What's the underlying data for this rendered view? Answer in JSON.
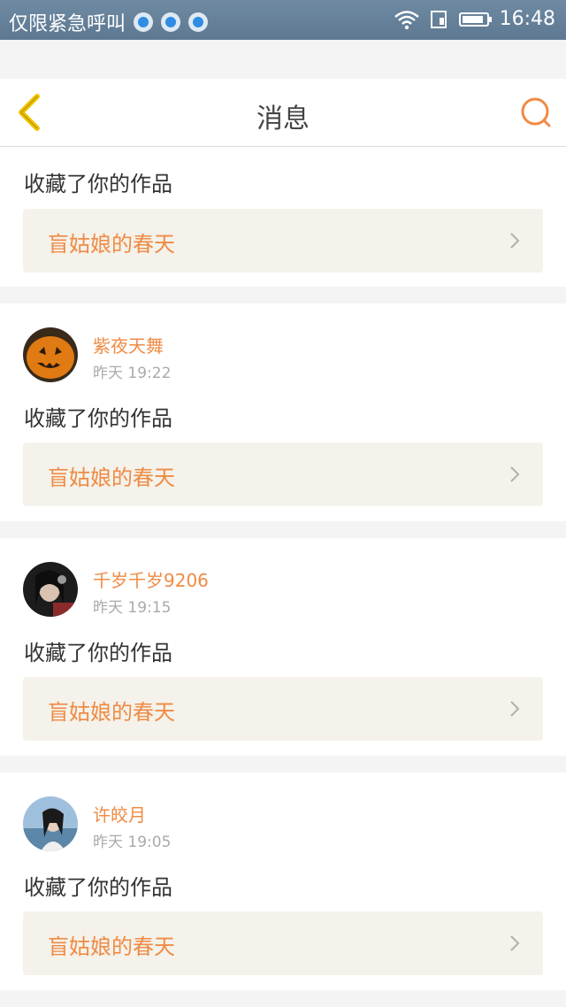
{
  "status_bar": {
    "carrier_text": "仅限紧急呼叫",
    "notification_icons": [
      "qq-icon",
      "qq-icon",
      "qq-icon"
    ],
    "time": "16:48"
  },
  "header": {
    "title": "消息",
    "back_icon": "chevron-left-icon",
    "search_icon": "search-icon"
  },
  "colors": {
    "accent": "#ef8b45",
    "back_icon": "#f2c300",
    "work_bg": "#f4f2ea"
  },
  "messages": [
    {
      "user": "",
      "time": "",
      "action": "收藏了你的作品",
      "work_title": "盲姑娘的春天"
    },
    {
      "user": "紫夜天舞",
      "time": "昨天 19:22",
      "action": "收藏了你的作品",
      "work_title": "盲姑娘的春天"
    },
    {
      "user": "千岁千岁9206",
      "time": "昨天 19:15",
      "action": "收藏了你的作品",
      "work_title": "盲姑娘的春天"
    },
    {
      "user": "许皎月",
      "time": "昨天 19:05",
      "action": "收藏了你的作品",
      "work_title": "盲姑娘的春天"
    }
  ]
}
